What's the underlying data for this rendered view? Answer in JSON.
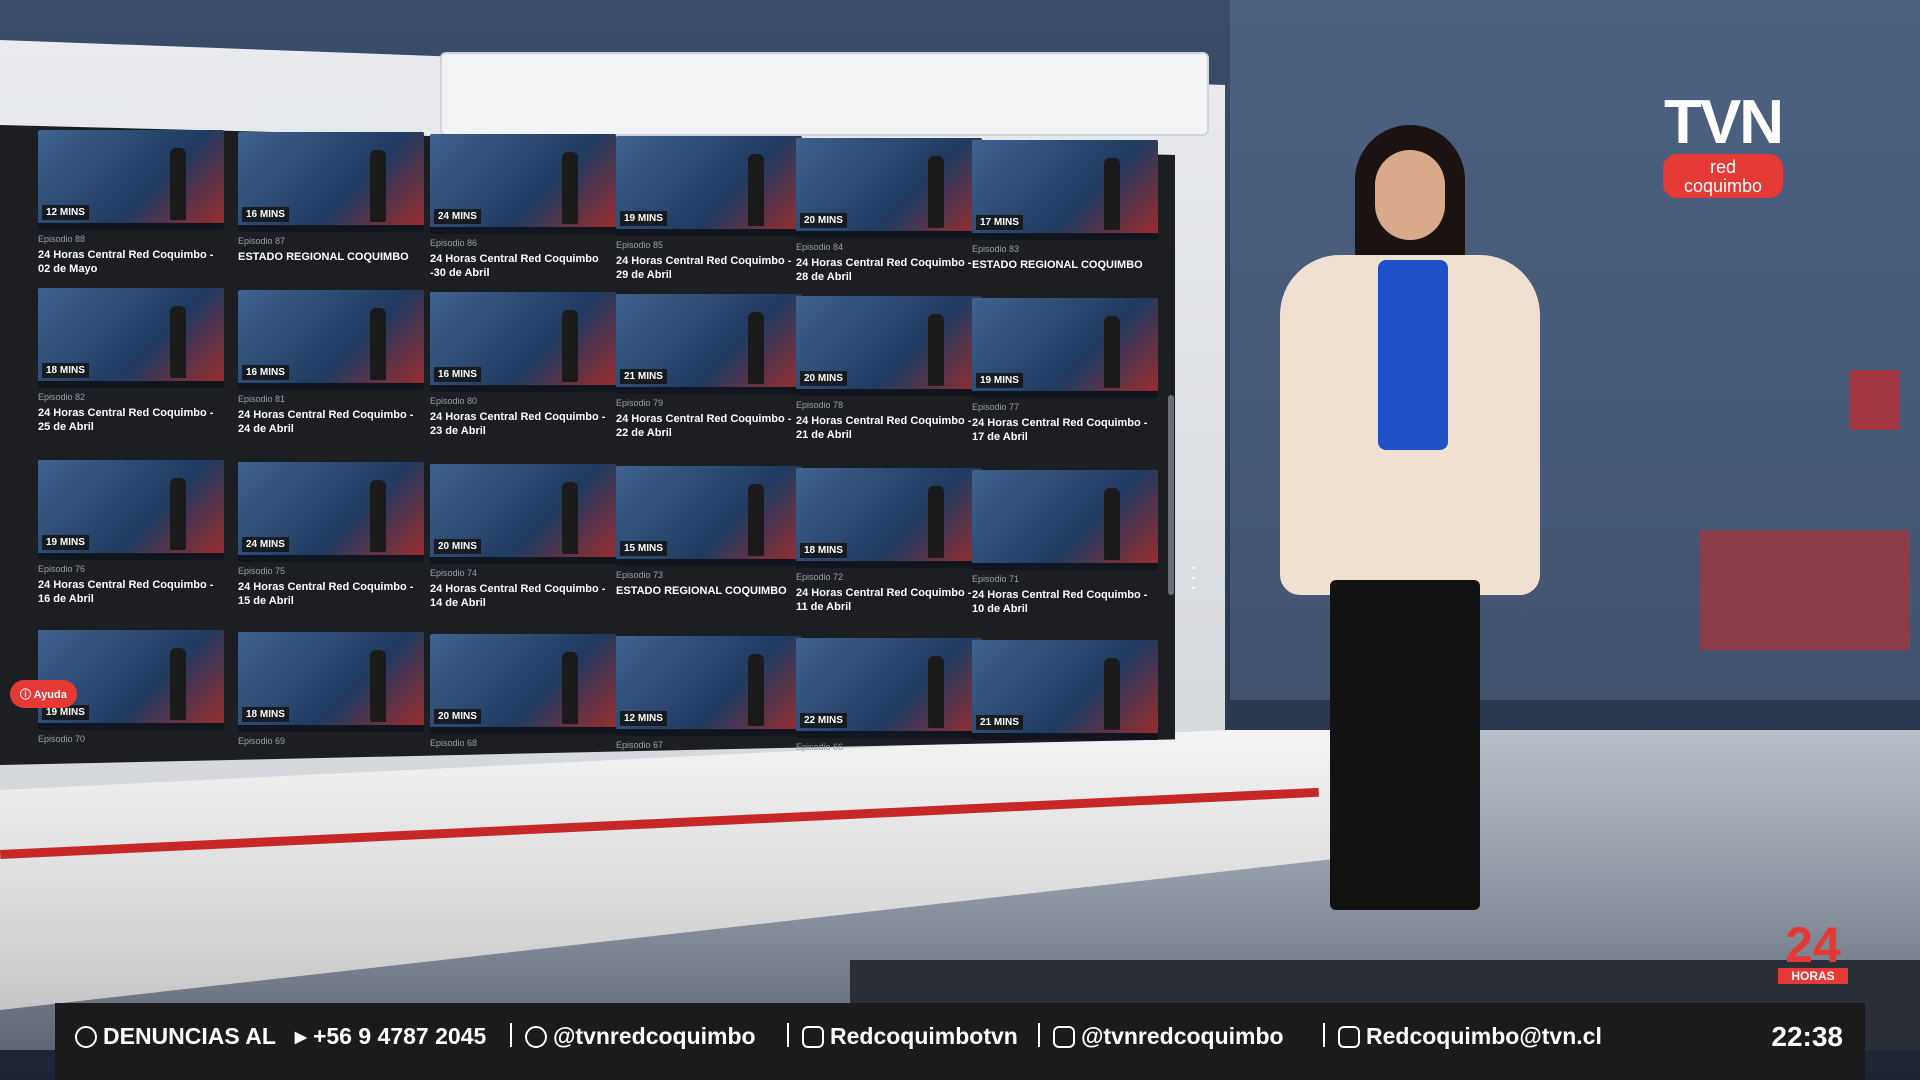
{
  "logo": {
    "tvn": "TVN",
    "line1": "red",
    "line2": "coquimbo",
    "h24_num": "24",
    "h24_label": "HORAS"
  },
  "screen": {
    "help_label": "Ayuda",
    "episodes": [
      {
        "duration": "12 MINS",
        "episode": "Episodio 88",
        "title": "24 Horas Central Red Coquimbo - 02 de Mayo"
      },
      {
        "duration": "16 MINS",
        "episode": "Episodio 87",
        "title": "ESTADO REGIONAL COQUIMBO"
      },
      {
        "duration": "24 MINS",
        "episode": "Episodio 86",
        "title": "24 Horas Central Red Coquimbo -30 de Abril"
      },
      {
        "duration": "19 MINS",
        "episode": "Episodio 85",
        "title": "24 Horas Central Red Coquimbo - 29 de Abril"
      },
      {
        "duration": "20 MINS",
        "episode": "Episodio 84",
        "title": "24 Horas Central Red Coquimbo - 28 de Abril"
      },
      {
        "duration": "17 MINS",
        "episode": "Episodio 83",
        "title": "ESTADO REGIONAL COQUIMBO"
      },
      {
        "duration": "18 MINS",
        "episode": "Episodio 82",
        "title": "24 Horas Central Red Coquimbo - 25 de Abril"
      },
      {
        "duration": "16 MINS",
        "episode": "Episodio 81",
        "title": "24 Horas Central Red Coquimbo - 24 de Abril"
      },
      {
        "duration": "16 MINS",
        "episode": "Episodio 80",
        "title": "24 Horas Central Red Coquimbo - 23 de Abril"
      },
      {
        "duration": "21 MINS",
        "episode": "Episodio 79",
        "title": "24 Horas Central Red Coquimbo - 22 de Abril"
      },
      {
        "duration": "20 MINS",
        "episode": "Episodio 78",
        "title": "24 Horas Central Red Coquimbo - 21 de Abril"
      },
      {
        "duration": "19 MINS",
        "episode": "Episodio 77",
        "title": "24 Horas Central Red Coquimbo - 17 de Abril"
      },
      {
        "duration": "19 MINS",
        "episode": "Episodio 76",
        "title": "24 Horas Central Red Coquimbo - 16 de Abril"
      },
      {
        "duration": "24 MINS",
        "episode": "Episodio 75",
        "title": "24 Horas Central Red Coquimbo - 15 de Abril"
      },
      {
        "duration": "20 MINS",
        "episode": "Episodio 74",
        "title": "24 Horas Central Red Coquimbo - 14 de Abril"
      },
      {
        "duration": "15 MINS",
        "episode": "Episodio 73",
        "title": "ESTADO REGIONAL COQUIMBO"
      },
      {
        "duration": "18 MINS",
        "episode": "Episodio 72",
        "title": "24 Horas Central Red Coquimbo - 11 de Abril"
      },
      {
        "duration": "",
        "episode": "Episodio 71",
        "title": "24 Horas Central Red Coquimbo - 10 de Abril"
      },
      {
        "duration": "19 MINS",
        "episode": "Episodio 70",
        "title": ""
      },
      {
        "duration": "18 MINS",
        "episode": "Episodio 69",
        "title": ""
      },
      {
        "duration": "20 MINS",
        "episode": "Episodio 68",
        "title": ""
      },
      {
        "duration": "12 MINS",
        "episode": "Episodio 67",
        "title": ""
      },
      {
        "duration": "22 MINS",
        "episode": "Episodio 66",
        "title": ""
      },
      {
        "duration": "21 MINS",
        "episode": "",
        "title": ""
      }
    ]
  },
  "ticker": {
    "denuncias": "DENUNCIAS AL",
    "phone": "+56 9 4787 2045",
    "instagram": "@tvnredcoquimbo",
    "facebook": "Redcoquimbotvn",
    "x": "@tvnredcoquimbo",
    "email": "Redcoquimbo@tvn.cl",
    "time": "22:38"
  }
}
